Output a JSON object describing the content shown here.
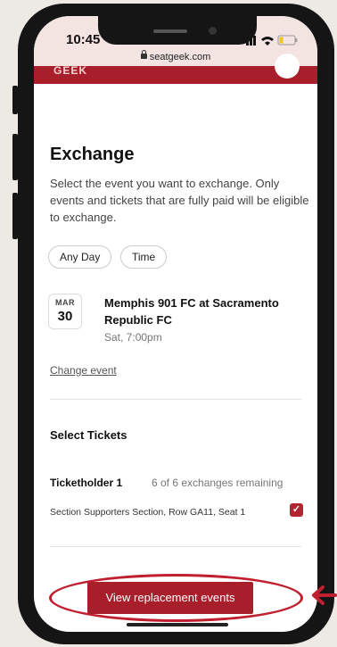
{
  "status_bar": {
    "time": "10:45",
    "url": "seatgeek.com"
  },
  "site_header": {
    "logo_text": "GEEK"
  },
  "exchange": {
    "title": "Exchange",
    "description": "Select the event you want to exchange. Only events and tickets that are fully paid will be eligible to exchange."
  },
  "filters": {
    "any_day": "Any Day",
    "time": "Time"
  },
  "event": {
    "month": "MAR",
    "day": "30",
    "title": "Memphis 901 FC at Sacramento Republic FC",
    "datetime": "Sat, 7:00pm",
    "change_link": "Change event"
  },
  "tickets": {
    "heading": "Select Tickets",
    "holder_name": "Ticketholder 1",
    "remaining": "6 of 6 exchanges remaining",
    "seat": "Section Supporters Section, Row GA11, Seat 1",
    "seat_checked": true
  },
  "cta": {
    "label": "View replacement events"
  },
  "colors": {
    "brand_red": "#a81f2b",
    "annotation_red": "#c01f30",
    "background": "#ede9e5"
  }
}
